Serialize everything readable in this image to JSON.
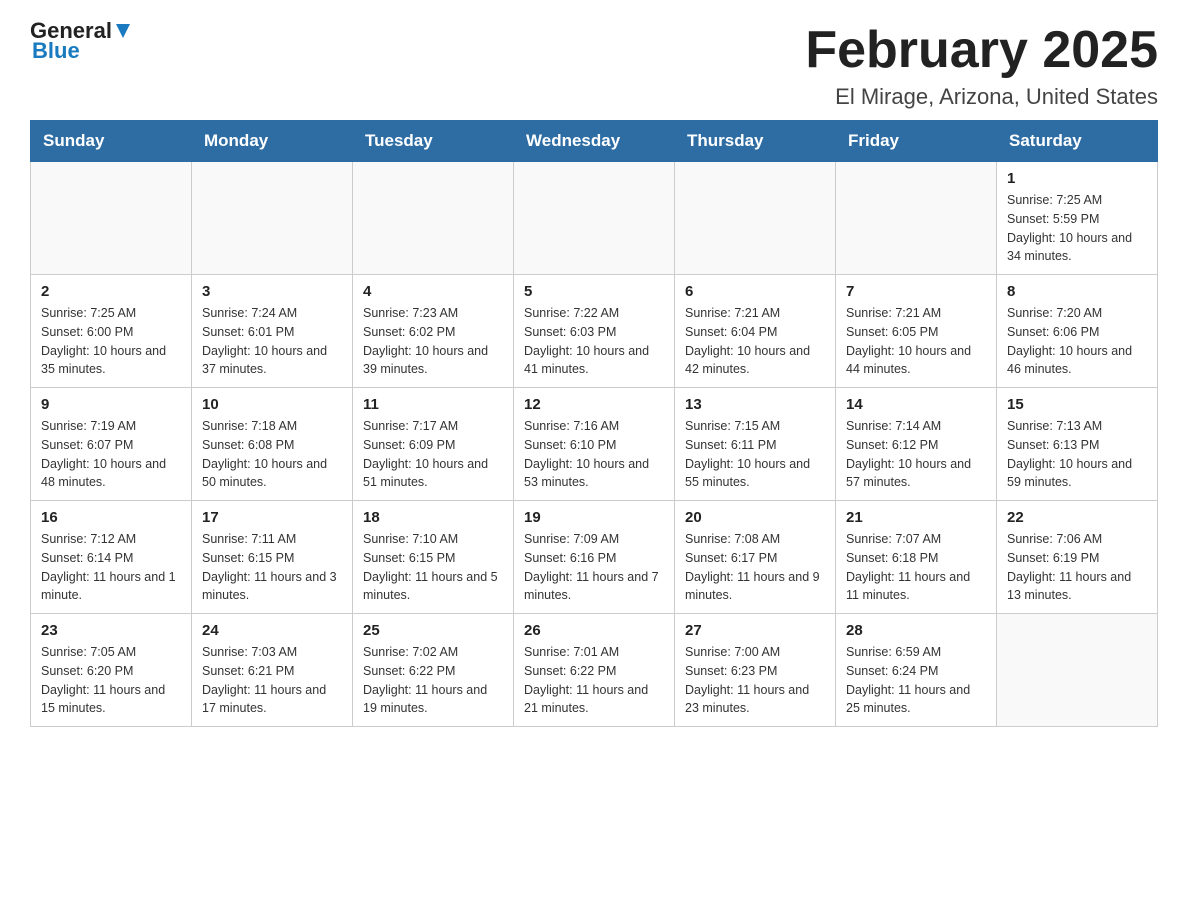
{
  "header": {
    "logo_general": "General",
    "logo_blue": "Blue",
    "title": "February 2025",
    "subtitle": "El Mirage, Arizona, United States"
  },
  "calendar": {
    "days_of_week": [
      "Sunday",
      "Monday",
      "Tuesday",
      "Wednesday",
      "Thursday",
      "Friday",
      "Saturday"
    ],
    "weeks": [
      [
        {
          "day": "",
          "info": ""
        },
        {
          "day": "",
          "info": ""
        },
        {
          "day": "",
          "info": ""
        },
        {
          "day": "",
          "info": ""
        },
        {
          "day": "",
          "info": ""
        },
        {
          "day": "",
          "info": ""
        },
        {
          "day": "1",
          "info": "Sunrise: 7:25 AM\nSunset: 5:59 PM\nDaylight: 10 hours and 34 minutes."
        }
      ],
      [
        {
          "day": "2",
          "info": "Sunrise: 7:25 AM\nSunset: 6:00 PM\nDaylight: 10 hours and 35 minutes."
        },
        {
          "day": "3",
          "info": "Sunrise: 7:24 AM\nSunset: 6:01 PM\nDaylight: 10 hours and 37 minutes."
        },
        {
          "day": "4",
          "info": "Sunrise: 7:23 AM\nSunset: 6:02 PM\nDaylight: 10 hours and 39 minutes."
        },
        {
          "day": "5",
          "info": "Sunrise: 7:22 AM\nSunset: 6:03 PM\nDaylight: 10 hours and 41 minutes."
        },
        {
          "day": "6",
          "info": "Sunrise: 7:21 AM\nSunset: 6:04 PM\nDaylight: 10 hours and 42 minutes."
        },
        {
          "day": "7",
          "info": "Sunrise: 7:21 AM\nSunset: 6:05 PM\nDaylight: 10 hours and 44 minutes."
        },
        {
          "day": "8",
          "info": "Sunrise: 7:20 AM\nSunset: 6:06 PM\nDaylight: 10 hours and 46 minutes."
        }
      ],
      [
        {
          "day": "9",
          "info": "Sunrise: 7:19 AM\nSunset: 6:07 PM\nDaylight: 10 hours and 48 minutes."
        },
        {
          "day": "10",
          "info": "Sunrise: 7:18 AM\nSunset: 6:08 PM\nDaylight: 10 hours and 50 minutes."
        },
        {
          "day": "11",
          "info": "Sunrise: 7:17 AM\nSunset: 6:09 PM\nDaylight: 10 hours and 51 minutes."
        },
        {
          "day": "12",
          "info": "Sunrise: 7:16 AM\nSunset: 6:10 PM\nDaylight: 10 hours and 53 minutes."
        },
        {
          "day": "13",
          "info": "Sunrise: 7:15 AM\nSunset: 6:11 PM\nDaylight: 10 hours and 55 minutes."
        },
        {
          "day": "14",
          "info": "Sunrise: 7:14 AM\nSunset: 6:12 PM\nDaylight: 10 hours and 57 minutes."
        },
        {
          "day": "15",
          "info": "Sunrise: 7:13 AM\nSunset: 6:13 PM\nDaylight: 10 hours and 59 minutes."
        }
      ],
      [
        {
          "day": "16",
          "info": "Sunrise: 7:12 AM\nSunset: 6:14 PM\nDaylight: 11 hours and 1 minute."
        },
        {
          "day": "17",
          "info": "Sunrise: 7:11 AM\nSunset: 6:15 PM\nDaylight: 11 hours and 3 minutes."
        },
        {
          "day": "18",
          "info": "Sunrise: 7:10 AM\nSunset: 6:15 PM\nDaylight: 11 hours and 5 minutes."
        },
        {
          "day": "19",
          "info": "Sunrise: 7:09 AM\nSunset: 6:16 PM\nDaylight: 11 hours and 7 minutes."
        },
        {
          "day": "20",
          "info": "Sunrise: 7:08 AM\nSunset: 6:17 PM\nDaylight: 11 hours and 9 minutes."
        },
        {
          "day": "21",
          "info": "Sunrise: 7:07 AM\nSunset: 6:18 PM\nDaylight: 11 hours and 11 minutes."
        },
        {
          "day": "22",
          "info": "Sunrise: 7:06 AM\nSunset: 6:19 PM\nDaylight: 11 hours and 13 minutes."
        }
      ],
      [
        {
          "day": "23",
          "info": "Sunrise: 7:05 AM\nSunset: 6:20 PM\nDaylight: 11 hours and 15 minutes."
        },
        {
          "day": "24",
          "info": "Sunrise: 7:03 AM\nSunset: 6:21 PM\nDaylight: 11 hours and 17 minutes."
        },
        {
          "day": "25",
          "info": "Sunrise: 7:02 AM\nSunset: 6:22 PM\nDaylight: 11 hours and 19 minutes."
        },
        {
          "day": "26",
          "info": "Sunrise: 7:01 AM\nSunset: 6:22 PM\nDaylight: 11 hours and 21 minutes."
        },
        {
          "day": "27",
          "info": "Sunrise: 7:00 AM\nSunset: 6:23 PM\nDaylight: 11 hours and 23 minutes."
        },
        {
          "day": "28",
          "info": "Sunrise: 6:59 AM\nSunset: 6:24 PM\nDaylight: 11 hours and 25 minutes."
        },
        {
          "day": "",
          "info": ""
        }
      ]
    ]
  }
}
